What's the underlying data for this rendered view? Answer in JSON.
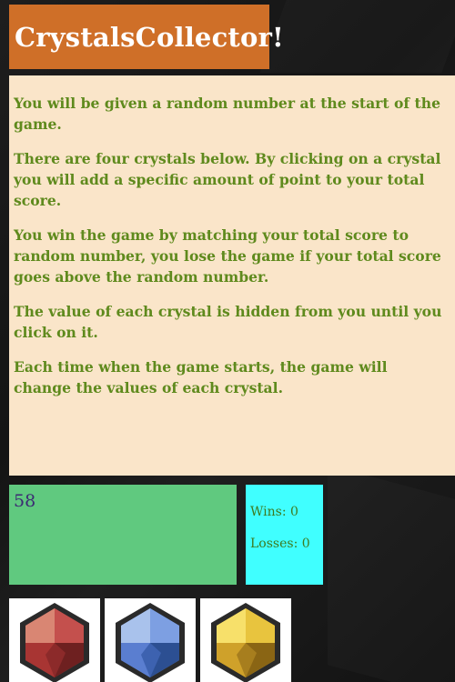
{
  "header": {
    "title": "CrystalsCollector!"
  },
  "instructions": {
    "paragraphs": [
      "You will be given a random number at the start of the game.",
      "There are four crystals below. By clicking on a crystal you will add a specific amount of point to your total score.",
      "You win the game by matching your total score to random number, you lose the game if your total score goes above the random number.",
      "The value of each crystal is hidden from you until you click on it.",
      "Each time when the game starts, the game will change the values of each crystal."
    ]
  },
  "game": {
    "random_number": "58",
    "wins_label": "Wins:",
    "wins_value": "0",
    "losses_label": "Losses:",
    "losses_value": "0"
  },
  "crystals": [
    {
      "icon": "red-crystal-icon",
      "color": "#c0484a"
    },
    {
      "icon": "blue-crystal-icon",
      "color": "#6d8fdc"
    },
    {
      "icon": "yellow-crystal-icon",
      "color": "#e1b53a"
    }
  ],
  "colors": {
    "title_bg": "#cf6f28",
    "instructions_bg": "#fae5c9",
    "instructions_text": "#5f8a1d",
    "score_bg": "#60c97f",
    "score_text": "#3c2a73",
    "stats_bg": "#40ffff",
    "stats_text": "#3e7a1f"
  }
}
